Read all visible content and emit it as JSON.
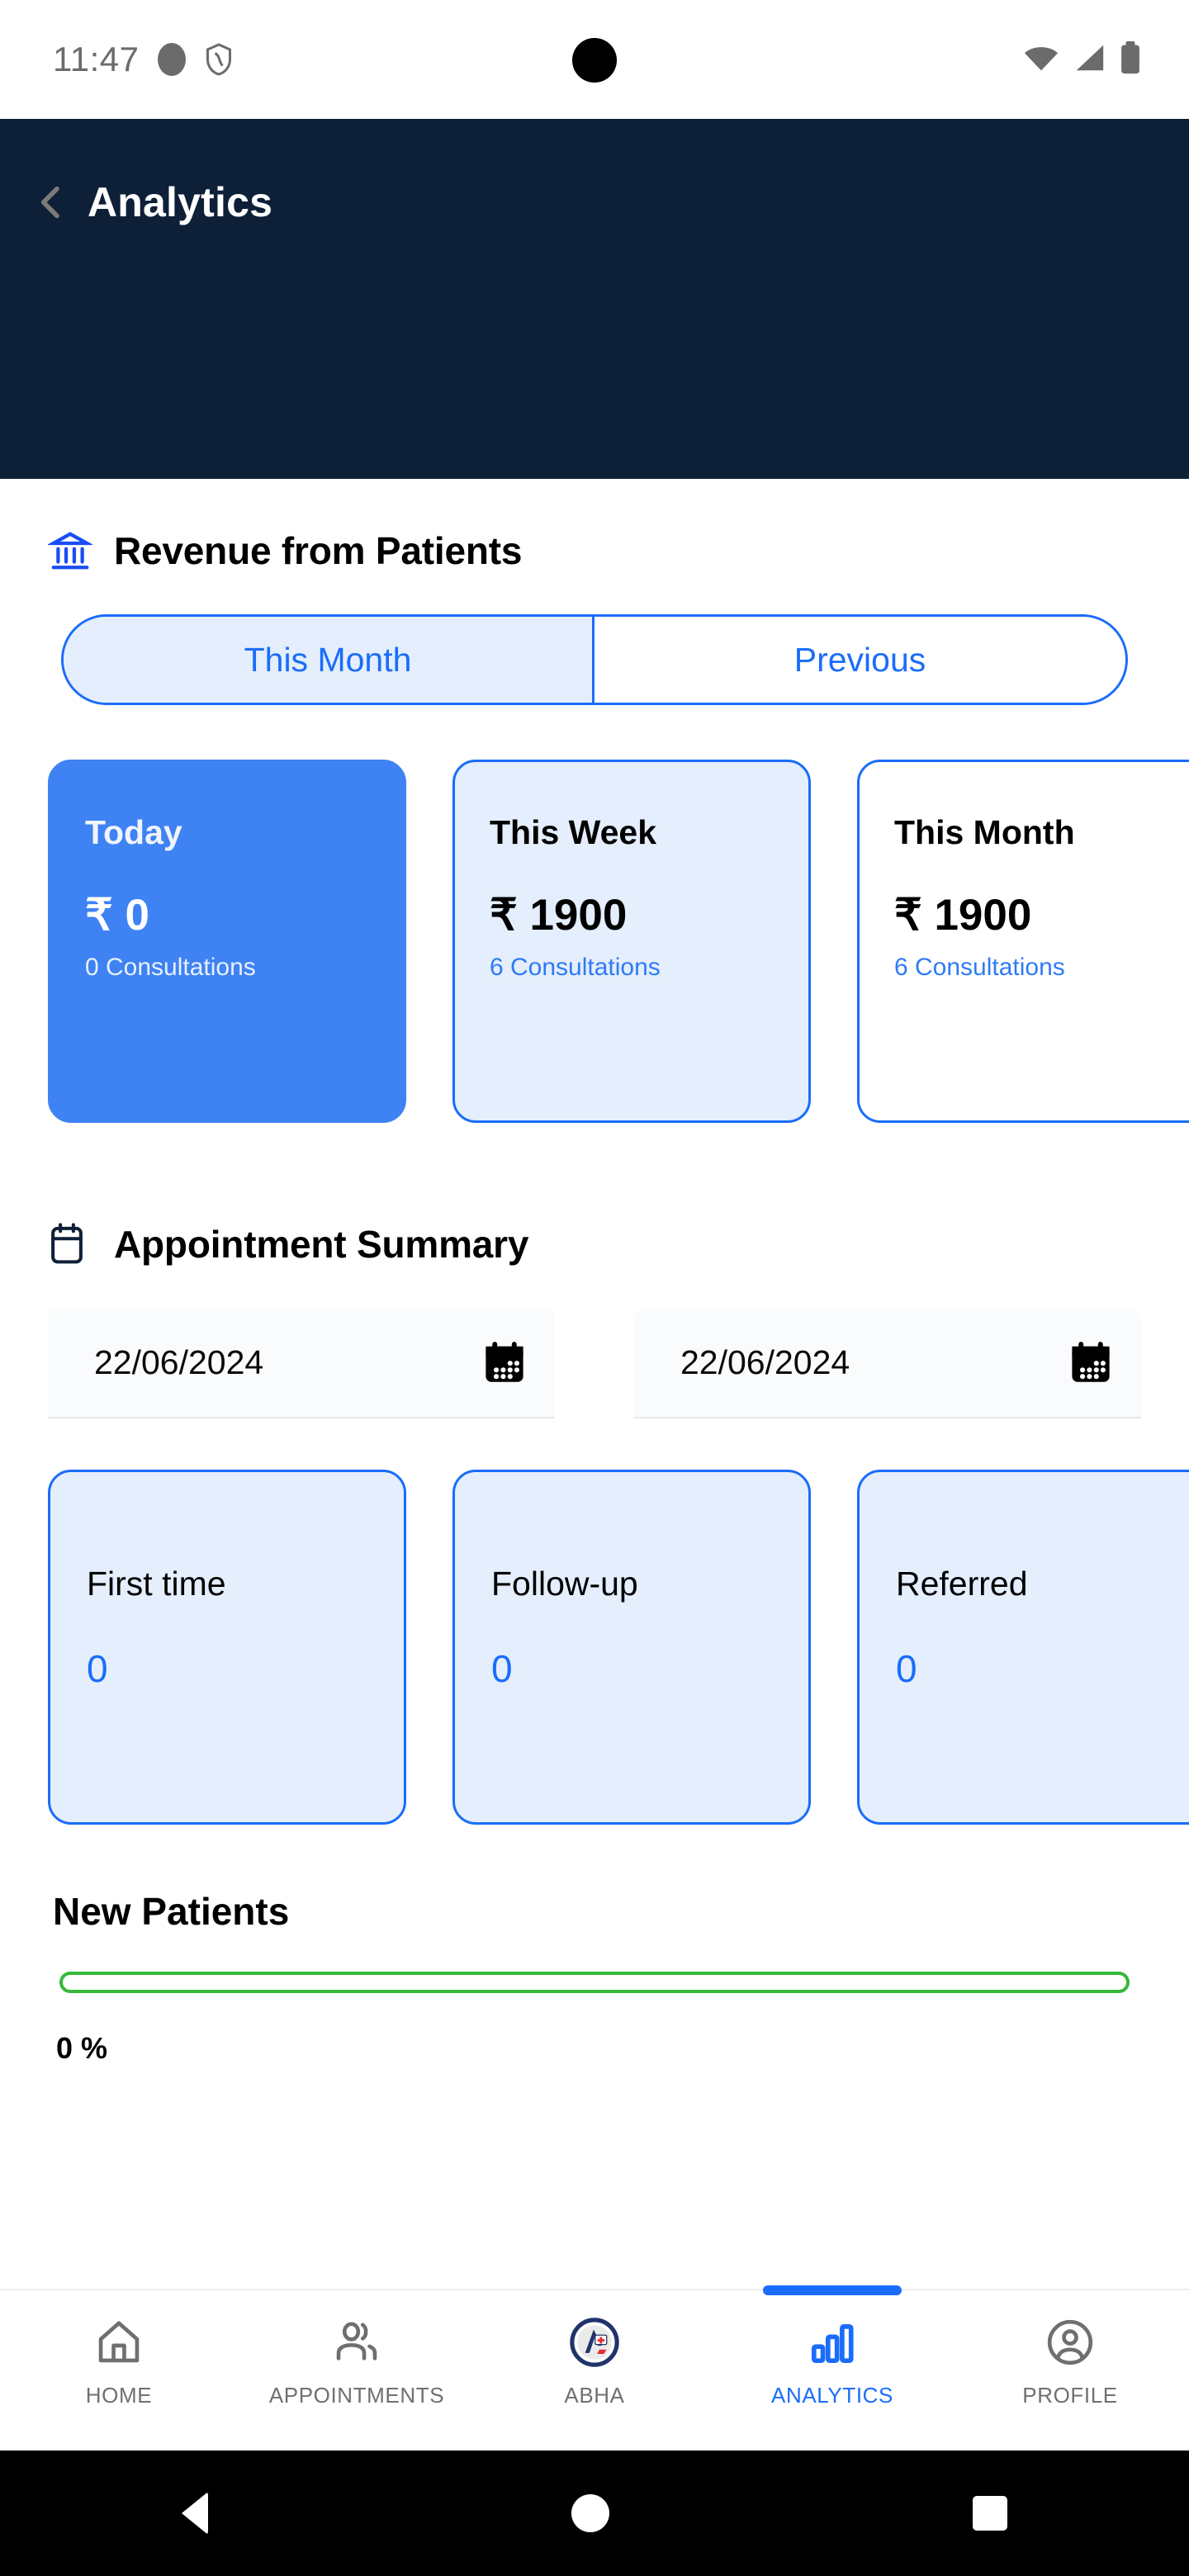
{
  "status_bar": {
    "time": "11:47",
    "left_icons": [
      "circle-icon",
      "shield-icon"
    ],
    "right_icons": [
      "wifi-icon",
      "cellular-signal-icon",
      "battery-icon"
    ]
  },
  "app_bar": {
    "back_icon": "back-chevron-icon",
    "title": "Analytics"
  },
  "revenue_section": {
    "icon": "bank-icon",
    "title": "Revenue from Patients",
    "tabs": [
      {
        "label": "This Month",
        "active": true
      },
      {
        "label": "Previous",
        "active": false
      }
    ],
    "cards": [
      {
        "label": "Today",
        "amount": "₹ 0",
        "consultations": "0 Consultations",
        "style": "solid"
      },
      {
        "label": "This Week",
        "amount": "₹ 1900",
        "consultations": "6 Consultations",
        "style": "tint"
      },
      {
        "label": "This Month",
        "amount": "₹ 1900",
        "consultations": "6 Consultations",
        "style": "plain"
      }
    ]
  },
  "appointment_section": {
    "icon": "calendar-icon",
    "title": "Appointment Summary",
    "date_from": "22/06/2024",
    "date_to": "22/06/2024",
    "date_icon": "calendar-solid-icon",
    "cards": [
      {
        "label": "First time",
        "value": "0"
      },
      {
        "label": "Follow-up",
        "value": "0"
      },
      {
        "label": "Referred",
        "value": "0"
      }
    ]
  },
  "new_patients": {
    "title": "New Patients",
    "percent_label": "0 %",
    "percent_value": 0,
    "bar_color": "#35b93a"
  },
  "bottom_nav": {
    "items": [
      {
        "label": "HOME",
        "icon": "home-icon",
        "active": false
      },
      {
        "label": "APPOINTMENTS",
        "icon": "people-icon",
        "active": false
      },
      {
        "label": "ABHA",
        "icon": "abha-logo-icon",
        "active": false
      },
      {
        "label": "ANALYTICS",
        "icon": "bar-chart-icon",
        "active": true
      },
      {
        "label": "PROFILE",
        "icon": "account-circle-icon",
        "active": false
      }
    ]
  },
  "system_nav": {
    "back": "system-back-icon",
    "home": "system-home-icon",
    "recents": "system-recents-icon"
  },
  "colors": {
    "header_navy": "#0e2038",
    "accent_blue": "#1a6dfa",
    "card_blue": "#3e82f4",
    "card_tint": "#e4eefc",
    "progress_green": "#35b93a"
  }
}
